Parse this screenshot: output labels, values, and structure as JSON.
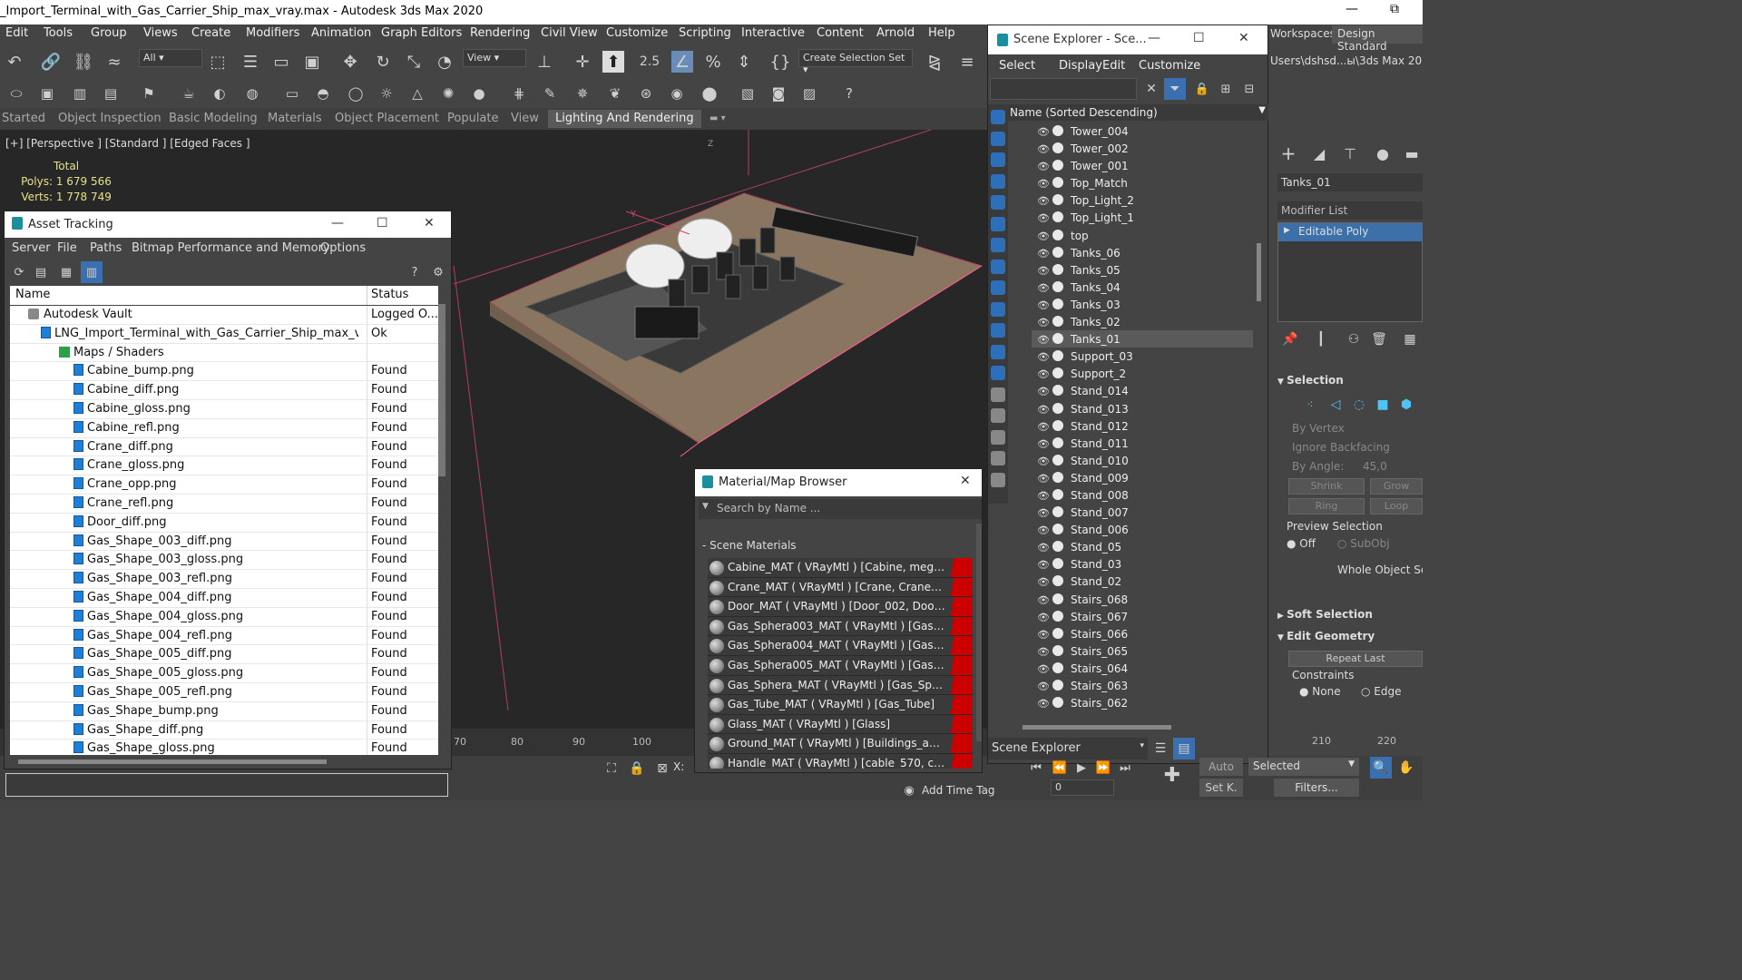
{
  "app": {
    "title": "_Import_Terminal_with_Gas_Carrier_Ship_max_vray.max - Autodesk 3ds Max 2020",
    "minimize": "—",
    "restore": "⧉"
  },
  "menu": [
    "Edit",
    "Tools",
    "Group",
    "Views",
    "Create",
    "Modifiers",
    "Animation",
    "Graph Editors",
    "Rendering",
    "Civil View",
    "Customize",
    "Scripting",
    "Interactive",
    "Content",
    "Arnold",
    "Help"
  ],
  "toolbar": {
    "filter": "All",
    "refcoord": "View",
    "selset": "Create Selection Set",
    "snap": "2.5"
  },
  "ribbon": {
    "tabs": [
      "Started",
      "Object Inspection",
      "Basic Modeling",
      "Materials",
      "Object Placement",
      "Populate",
      "View",
      "Lighting And Rendering"
    ]
  },
  "viewport": {
    "label": "[+] [Perspective ] [Standard ] [Edged Faces ]",
    "stats": {
      "total": "Total",
      "polys_label": "Polys:",
      "polys": "1 679 566",
      "verts_label": "Verts:",
      "verts": "1 778 749"
    }
  },
  "timeline": {
    "ticks": [
      "70",
      "80",
      "90",
      "100",
      "210",
      "220"
    ]
  },
  "asset": {
    "title": "Asset Tracking",
    "menu": [
      "Server",
      "File",
      "Paths",
      "Bitmap Performance and Memory",
      "Options"
    ],
    "col_name": "Name",
    "col_status": "Status",
    "rows": [
      {
        "name": "Autodesk Vault",
        "status": "Logged O...",
        "lvl": 0,
        "kind": "vault"
      },
      {
        "name": "LNG_Import_Terminal_with_Gas_Carrier_Ship_max_vray.m...",
        "status": "Ok",
        "lvl": 1,
        "kind": "file"
      },
      {
        "name": "Maps / Shaders",
        "status": "",
        "lvl": 2,
        "kind": "map"
      },
      {
        "name": "Cabine_bump.png",
        "status": "Found",
        "lvl": 3,
        "kind": "file"
      },
      {
        "name": "Cabine_diff.png",
        "status": "Found",
        "lvl": 3,
        "kind": "file"
      },
      {
        "name": "Cabine_gloss.png",
        "status": "Found",
        "lvl": 3,
        "kind": "file"
      },
      {
        "name": "Cabine_refl.png",
        "status": "Found",
        "lvl": 3,
        "kind": "file"
      },
      {
        "name": "Crane_diff.png",
        "status": "Found",
        "lvl": 3,
        "kind": "file"
      },
      {
        "name": "Crane_gloss.png",
        "status": "Found",
        "lvl": 3,
        "kind": "file"
      },
      {
        "name": "Crane_opp.png",
        "status": "Found",
        "lvl": 3,
        "kind": "file"
      },
      {
        "name": "Crane_refl.png",
        "status": "Found",
        "lvl": 3,
        "kind": "file"
      },
      {
        "name": "Door_diff.png",
        "status": "Found",
        "lvl": 3,
        "kind": "file"
      },
      {
        "name": "Gas_Shape_003_diff.png",
        "status": "Found",
        "lvl": 3,
        "kind": "file"
      },
      {
        "name": "Gas_Shape_003_gloss.png",
        "status": "Found",
        "lvl": 3,
        "kind": "file"
      },
      {
        "name": "Gas_Shape_003_refl.png",
        "status": "Found",
        "lvl": 3,
        "kind": "file"
      },
      {
        "name": "Gas_Shape_004_diff.png",
        "status": "Found",
        "lvl": 3,
        "kind": "file"
      },
      {
        "name": "Gas_Shape_004_gloss.png",
        "status": "Found",
        "lvl": 3,
        "kind": "file"
      },
      {
        "name": "Gas_Shape_004_refl.png",
        "status": "Found",
        "lvl": 3,
        "kind": "file"
      },
      {
        "name": "Gas_Shape_005_diff.png",
        "status": "Found",
        "lvl": 3,
        "kind": "file"
      },
      {
        "name": "Gas_Shape_005_gloss.png",
        "status": "Found",
        "lvl": 3,
        "kind": "file"
      },
      {
        "name": "Gas_Shape_005_refl.png",
        "status": "Found",
        "lvl": 3,
        "kind": "file"
      },
      {
        "name": "Gas_Shape_bump.png",
        "status": "Found",
        "lvl": 3,
        "kind": "file"
      },
      {
        "name": "Gas_Shape_diff.png",
        "status": "Found",
        "lvl": 3,
        "kind": "file"
      },
      {
        "name": "Gas_Shape_gloss.png",
        "status": "Found",
        "lvl": 3,
        "kind": "file"
      }
    ]
  },
  "matbrowser": {
    "title": "Material/Map Browser",
    "search": "Search by Name ...",
    "section": "Scene Materials",
    "rows": [
      "Cabine_MAT  ( VRayMtl )  [Cabine, megaphone_...",
      "Crane_MAT  ( VRayMtl )  [Crane, Crane_01, Cran...",
      "Door_MAT  ( VRayMtl )  [Door_002, Door_003, D...",
      "Gas_Sphera003_MAT  ( VRayMtl )  [Gas_Sphera0...",
      "Gas_Sphera004_MAT  ( VRayMtl )  [Gas_Sphera0...",
      "Gas_Sphera005_MAT  ( VRayMtl )  [Gas_Sphera0...",
      "Gas_Sphera_MAT  ( VRayMtl )  [Gas_Sphera]",
      "Gas_Tube_MAT  ( VRayMtl )  [Gas_Tube]",
      "Glass_MAT  ( VRayMtl )  [Glass]",
      "Ground_MAT  ( VRayMtl )  [Buildings_and_Stairs...",
      "Handle_MAT  ( VRayMtl )  [cable_570, cable_571..."
    ]
  },
  "scene": {
    "title": "Scene Explorer - Sce...",
    "menu": [
      "Select",
      "Display",
      "Edit",
      "Customize"
    ],
    "header": "Name (Sorted Descending)",
    "footer": "Scene Explorer",
    "selected": "Tanks_01",
    "items": [
      "Tower_004",
      "Tower_002",
      "Tower_001",
      "Top_Match",
      "Top_Light_2",
      "Top_Light_1",
      "top",
      "Tanks_06",
      "Tanks_05",
      "Tanks_04",
      "Tanks_03",
      "Tanks_02",
      "Tanks_01",
      "Support_03",
      "Support_2",
      "Stand_014",
      "Stand_013",
      "Stand_012",
      "Stand_011",
      "Stand_010",
      "Stand_009",
      "Stand_008",
      "Stand_007",
      "Stand_006",
      "Stand_05",
      "Stand_03",
      "Stand_02",
      "Stairs_068",
      "Stairs_067",
      "Stairs_066",
      "Stairs_065",
      "Stairs_064",
      "Stairs_063",
      "Stairs_062"
    ]
  },
  "cmd": {
    "workspaces_label": "Workspaces:",
    "workspace": "Design Standard",
    "path": "Users\\dshsd...ы\\3ds Max 2020",
    "object": "Tanks_01",
    "modlist": "Modifier List",
    "modifier": "Editable Poly",
    "selection": "Selection",
    "by_vertex": "By Vertex",
    "ignore_bf": "Ignore Backfacing",
    "by_angle": "By Angle:",
    "angle": "45,0",
    "shrink": "Shrink",
    "grow": "Grow",
    "ring": "Ring",
    "loop": "Loop",
    "preview": "Preview Selection",
    "off": "Off",
    "subobj": "SubObj",
    "whole": "Whole Object Sele",
    "soft": "Soft Selection",
    "editgeo": "Edit Geometry",
    "repeat": "Repeat Last",
    "constraints": "Constraints",
    "none": "None",
    "edge": "Edge"
  },
  "status": {
    "addtag": "Add Time Tag",
    "x": "X:",
    "auto": "Auto",
    "selected": "Selected",
    "setk": "Set K.",
    "filters": "Filters...",
    "frame": "0"
  }
}
